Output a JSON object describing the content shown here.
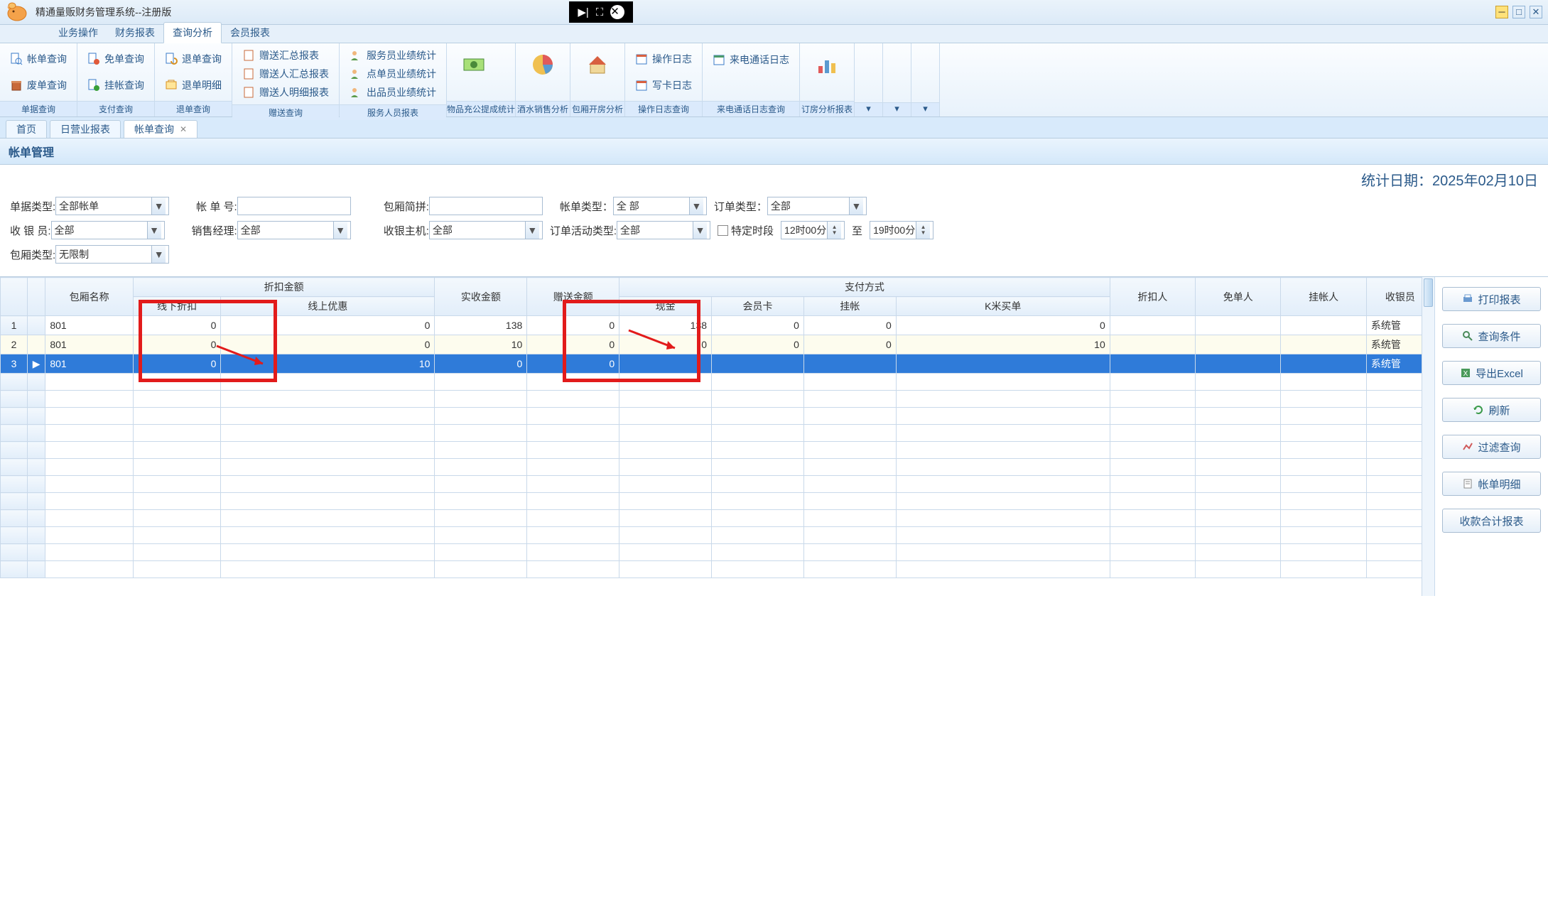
{
  "window": {
    "title": "精通量贩财务管理系统--注册版"
  },
  "menu": {
    "items": [
      "业务操作",
      "财务报表",
      "查询分析",
      "会员报表"
    ],
    "active": 2
  },
  "ribbon": {
    "g0": {
      "label": "单据查询",
      "btns": [
        "帐单查询",
        "废单查询"
      ]
    },
    "g1": {
      "label": "支付查询",
      "btns": [
        "免单查询",
        "挂帐查询"
      ]
    },
    "g2": {
      "label": "退单查询",
      "btns": [
        "退单查询",
        "退单明细"
      ]
    },
    "g3": {
      "label": "赠送查询",
      "btns": [
        "赠送汇总报表",
        "赠送人汇总报表",
        "赠送人明细报表"
      ]
    },
    "g4": {
      "label": "服务人员报表",
      "btns": [
        "服务员业绩统计",
        "点单员业绩统计",
        "出品员业绩统计"
      ]
    },
    "g5": {
      "label": "物品充公提成统计"
    },
    "g6": {
      "label": "酒水销售分析"
    },
    "g7": {
      "label": "包厢开房分析"
    },
    "g8": {
      "label": "操作日志查询",
      "btns": [
        "操作日志",
        "写卡日志"
      ]
    },
    "g9": {
      "label": "来电通话日志查询",
      "btns": [
        "来电通话日志"
      ]
    },
    "g10": {
      "label": "订房分析报表"
    }
  },
  "tabs": {
    "items": [
      "首页",
      "日营业报表",
      "帐单查询"
    ],
    "active": 2
  },
  "page": {
    "title": "帐单管理",
    "stat_date_label": "统计日期：",
    "stat_date": "2025年02月10日"
  },
  "filters": {
    "bill_kind_label": "单据类型:",
    "bill_kind": "全部帐单",
    "bill_no_label": "帐 单 号:",
    "bill_no": "",
    "room_abbr_label": "包厢简拼:",
    "room_abbr": "",
    "bill_type_label": "帐单类型：",
    "bill_type": "全 部",
    "order_type_label": "订单类型：",
    "order_type": "全部",
    "cashier_label": "收 银 员:",
    "cashier": "全部",
    "mgr_label": "销售经理:",
    "mgr": "全部",
    "host_label": "收银主机:",
    "host": "全部",
    "act_type_label": "订单活动类型:",
    "act_type": "全部",
    "time_check_label": "特定时段",
    "time_from": "12时00分",
    "time_to_label": "至",
    "time_to": "19时00分",
    "room_type_label": "包厢类型:",
    "room_type": "无限制"
  },
  "grid": {
    "headers": {
      "room": "包厢名称",
      "discount_group": "折扣金额",
      "offline": "线下折扣",
      "online": "线上优惠",
      "actual": "实收金额",
      "gift": "赠送金额",
      "pay_group": "支付方式",
      "cash": "现金",
      "member": "会员卡",
      "credit": "挂帐",
      "kmi": "K米买单",
      "discounter": "折扣人",
      "freeman": "免单人",
      "creditman": "挂帐人",
      "cashierp": "收银员"
    },
    "rows": [
      {
        "room": "801",
        "offline": "0",
        "online": "0",
        "actual": "138",
        "gift": "0",
        "cash": "138",
        "member": "0",
        "credit": "0",
        "kmi": "0",
        "cashierp": "系统管"
      },
      {
        "room": "801",
        "offline": "0",
        "online": "0",
        "actual": "10",
        "gift": "0",
        "cash": "0",
        "member": "0",
        "credit": "0",
        "kmi": "10",
        "cashierp": "系统管"
      },
      {
        "room": "801",
        "offline": "0",
        "online": "10",
        "actual": "0",
        "gift": "0",
        "cash": "",
        "member": "",
        "credit": "",
        "kmi": "",
        "cashierp": "系统管"
      }
    ]
  },
  "side": {
    "print": "打印报表",
    "query": "查询条件",
    "export": "导出Excel",
    "refresh": "刷新",
    "filter": "过滤查询",
    "detail": "帐单明细",
    "receipt": "收款合计报表"
  }
}
